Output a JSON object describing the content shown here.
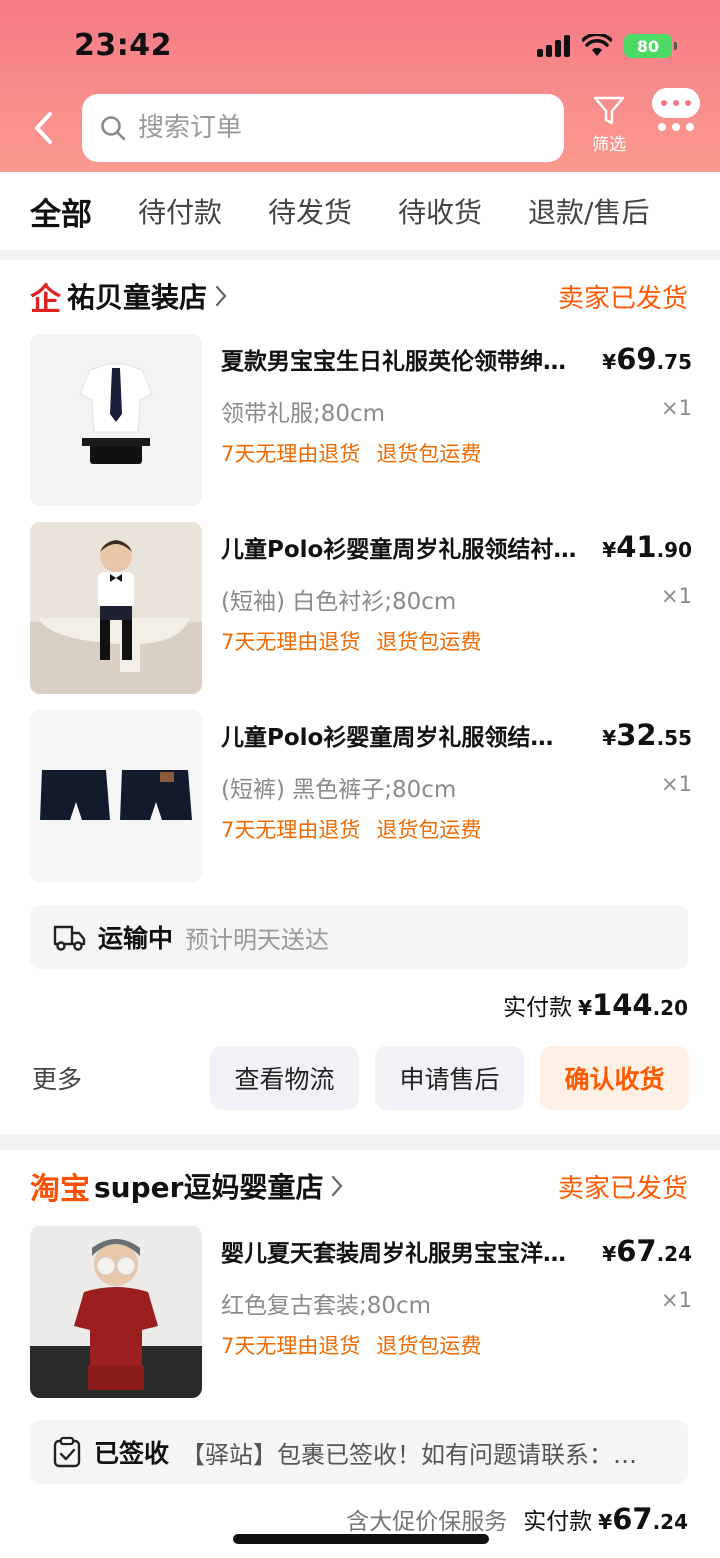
{
  "status_bar": {
    "time": "23:42",
    "battery": "80"
  },
  "header": {
    "search_placeholder": "搜索订单",
    "filter_label": "筛选"
  },
  "tabs": [
    {
      "label": "全部",
      "active": true
    },
    {
      "label": "待付款"
    },
    {
      "label": "待发货"
    },
    {
      "label": "待收货"
    },
    {
      "label": "退款/售后"
    }
  ],
  "orders": [
    {
      "shop_name": "祐贝童装店",
      "status": "卖家已发货",
      "items": [
        {
          "title": "夏款男宝宝生日礼服英伦领带绅…",
          "price_int": "69",
          "price_dec": ".75",
          "spec": "领带礼服;80cm",
          "qty": "×1",
          "tags": [
            "7天无理由退货",
            "退货包运费"
          ]
        },
        {
          "title": "儿童Polo衫婴童周岁礼服领结衬…",
          "price_int": "41",
          "price_dec": ".90",
          "spec": "(短袖) 白色衬衫;80cm",
          "qty": "×1",
          "tags": [
            "7天无理由退货",
            "退货包运费"
          ]
        },
        {
          "title": "儿童Polo衫婴童周岁礼服领结…",
          "price_int": "32",
          "price_dec": ".55",
          "spec": "(短裤) 黑色裤子;80cm",
          "qty": "×1",
          "tags": [
            "7天无理由退货",
            "退货包运费"
          ]
        }
      ],
      "delivery": {
        "status": "运输中",
        "desc": "预计明天送达"
      },
      "total_label": "实付款",
      "total_int": "144",
      "total_dec": ".20",
      "more": "更多",
      "buttons": {
        "logistics": "查看物流",
        "aftersale": "申请售后",
        "confirm": "确认收货"
      }
    },
    {
      "shop_logo": "淘宝",
      "shop_name": "super逗妈婴童店",
      "status": "卖家已发货",
      "items": [
        {
          "title": "婴儿夏天套装周岁礼服男宝宝洋…",
          "price_int": "67",
          "price_dec": ".24",
          "spec": "红色复古套装;80cm",
          "qty": "×1",
          "tags": [
            "7天无理由退货",
            "退货包运费"
          ]
        }
      ],
      "delivery": {
        "status": "已签收",
        "desc": "【驿站】包裹已签收！如有问题请联系：…"
      },
      "total_extra": "含大促价保服务",
      "total_label": "实付款",
      "total_int": "67",
      "total_dec": ".24"
    }
  ],
  "currency": "¥",
  "colors": {
    "accent": "#ff5a00",
    "header_top": "#f57a86",
    "header_bottom": "#fb9a8f",
    "qi_logo": "#e02121"
  }
}
